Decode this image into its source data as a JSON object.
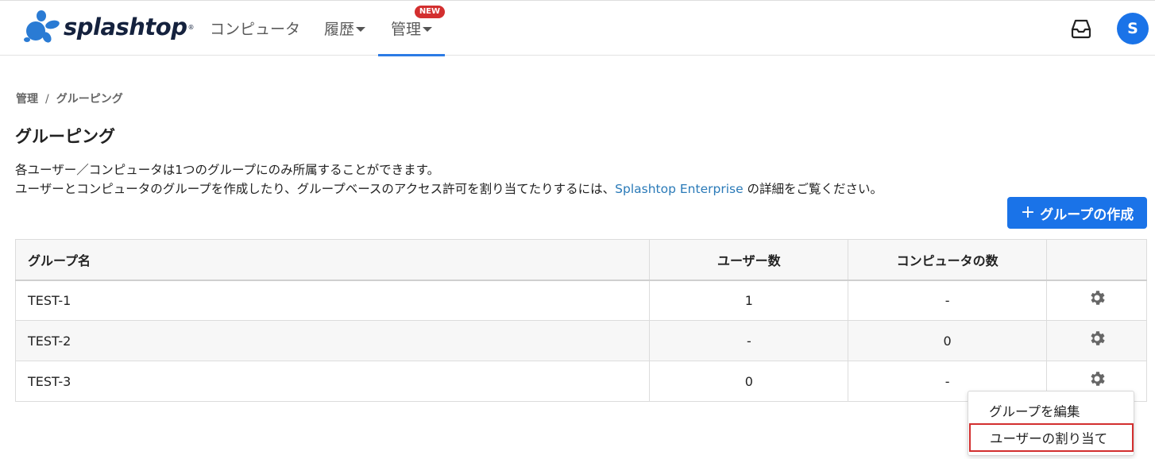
{
  "header": {
    "brand": "splashtop",
    "brand_mark": "®",
    "nav": {
      "computers": "コンピュータ",
      "history": "履歴",
      "manage": "管理",
      "new_badge": "NEW"
    },
    "inbox_icon": "inbox-icon",
    "avatar_initial": "S",
    "accent_color": "#1a73e8"
  },
  "breadcrumb": {
    "root": "管理",
    "separator": "/",
    "current": "グルーピング"
  },
  "page": {
    "title": "グルーピング",
    "desc_line1": "各ユーザー／コンピュータは1つのグループにのみ所属することができます。",
    "desc_line2_prefix": "ユーザーとコンピュータのグループを作成したり、グループベースのアクセス許可を割り当てたりするには、",
    "desc_link": "Splashtop Enterprise",
    "desc_line2_suffix": " の詳細をご覧ください。",
    "create_button": "グループの作成"
  },
  "table": {
    "headers": {
      "name": "グループ名",
      "users": "ユーザー数",
      "computers": "コンピュータの数",
      "actions": ""
    },
    "rows": [
      {
        "name": "TEST-1",
        "users": "1",
        "computers": "-"
      },
      {
        "name": "TEST-2",
        "users": "-",
        "computers": "0"
      },
      {
        "name": "TEST-3",
        "users": "0",
        "computers": "-"
      }
    ]
  },
  "menu": {
    "edit": "グループを編集",
    "assign": "ユーザーの割り当て",
    "highlight_color": "#d32f2f"
  }
}
